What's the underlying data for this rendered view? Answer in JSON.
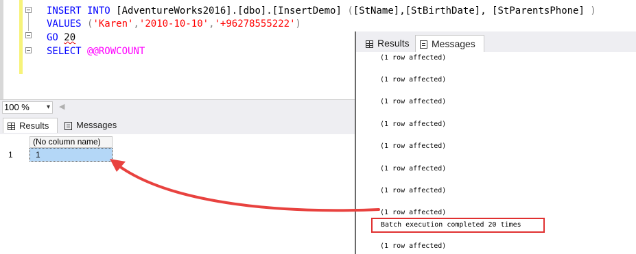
{
  "editor": {
    "line1": {
      "kw1": "INSERT INTO",
      "table": "[AdventureWorks2016].[dbo].[InsertDemo]",
      "cols_open": "(",
      "cols": "[StName],[StBirthDate], [StParentsPhone]",
      "cols_close": ")"
    },
    "line2": {
      "kw": "VALUES",
      "open": "(",
      "v1": "'Karen'",
      "comma1": ",",
      "v2": "'2010-10-10'",
      "comma2": ",",
      "v3": "'+96278555222'",
      "close": ")"
    },
    "line3": {
      "kw": "GO",
      "count": "20"
    },
    "line4": {
      "kw": "SELECT",
      "fn": "@@ROWCOUNT"
    }
  },
  "zoom": {
    "value": "100 %",
    "arrow": "▾",
    "scroll_left": "◀"
  },
  "bottom_panel": {
    "tabs": [
      {
        "label": "Results",
        "icon": "grid-icon",
        "active": true
      },
      {
        "label": "Messages",
        "icon": "messages-icon",
        "active": false
      }
    ],
    "grid": {
      "column_header": "(No column name)",
      "rows": [
        {
          "row_number": "1",
          "value": "1"
        }
      ]
    }
  },
  "messages_panel": {
    "tabs": [
      {
        "label": "Results",
        "icon": "grid-icon",
        "active": false
      },
      {
        "label": "Messages",
        "icon": "messages-icon",
        "active": true
      }
    ],
    "lines": [
      "(1 row affected)",
      "(1 row affected)",
      "(1 row affected)",
      "(1 row affected)",
      "(1 row affected)",
      "(1 row affected)",
      "(1 row affected)",
      "(1 row affected)"
    ],
    "batch_message": "Batch execution completed 20 times",
    "last_line": "(1 row affected)"
  },
  "colors": {
    "keyword": "#0000ff",
    "string": "#ff0000",
    "system_function": "#ff00ff",
    "highlight_box": "#e03030",
    "selected_cell": "#b4d7f7"
  }
}
